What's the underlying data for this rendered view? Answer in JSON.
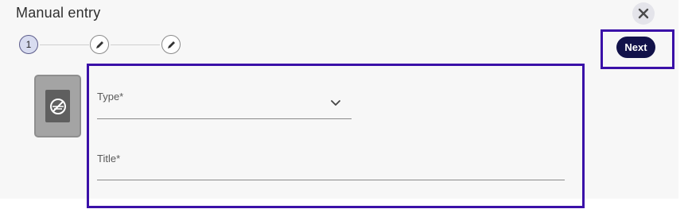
{
  "dialog": {
    "title": "Manual entry",
    "close_icon": "close-icon"
  },
  "stepper": {
    "steps": [
      {
        "label": "1",
        "state": "active"
      },
      {
        "icon": "pencil-icon",
        "state": "pending"
      },
      {
        "icon": "pencil-icon",
        "state": "pending"
      }
    ]
  },
  "actions": {
    "next_label": "Next"
  },
  "document": {
    "icon": "document-placeholder-icon"
  },
  "form": {
    "type_label": "Type*",
    "type_value": "",
    "title_label": "Title*",
    "title_value": ""
  },
  "colors": {
    "accent": "#12124a",
    "highlight": "#3a10a8",
    "panel_bg": "#f7f7f7"
  }
}
